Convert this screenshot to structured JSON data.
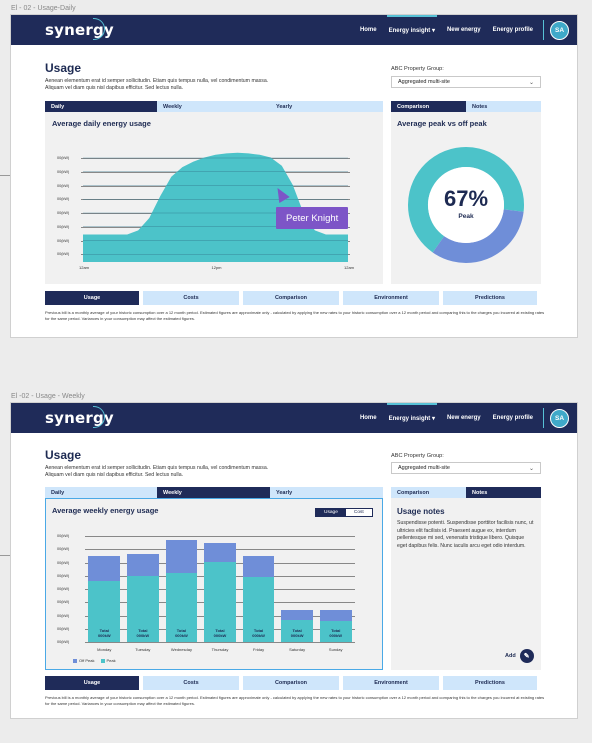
{
  "frames": [
    {
      "label": "El - 02 - Usage-Daily",
      "brand": "synergy",
      "nav": [
        "Home",
        "Energy insight ▾",
        "New energy",
        "Energy profile"
      ],
      "avatar": "SA",
      "title": "Usage",
      "description": "Aenean elementum erat id semper sollicitudin. Etiam quis tempus nulla, vel condimentum massa. Aliquam vel diam quis nisl dapibus efficitur. Sed lectus nulla.",
      "group_label": "ABC Property Group:",
      "group_value": "Aggregated multi-site",
      "period_tabs": [
        "Daily",
        "Weekly",
        "Yearly"
      ],
      "side_tabs": [
        "Comparison",
        "Notes"
      ],
      "chart_title": "Average daily energy usage",
      "y_ticks": [
        "00(kW)",
        "00(kW)",
        "00(kW)",
        "00(kW)",
        "00(kW)",
        "00(kW)",
        "00(kW)",
        "00(kW)"
      ],
      "x_ticks": [
        "12am",
        "12pm",
        "12am"
      ],
      "tooltip": "Peter Knight",
      "donut_title": "Average peak vs off peak",
      "donut_value": "67%",
      "donut_label": "Peak",
      "bottom_tabs": [
        "Usage",
        "Costs",
        "Comparison",
        "Environment",
        "Predictions"
      ],
      "footnote": "Previous bill is a monthly average of your historic consumption over a 12 month period. Estimated figures are approximate only - calculated by applying the new rates to your historic consumption over a 12 month period and comparing this to the charges you incurred at existing rates for the same period. Variances in your consumption may affect the estimated figures."
    },
    {
      "label": "El -02 - Usage - Weekly",
      "brand": "synergy",
      "nav": [
        "Home",
        "Energy insight ▾",
        "New energy",
        "Energy profile"
      ],
      "avatar": "SA",
      "title": "Usage",
      "description": "Aenean elementum erat id semper sollicitudin. Etiam quis tempus nulla, vel condimentum massa. Aliquam vel diam quis nisl dapibus efficitur. Sed lectus nulla.",
      "group_label": "ABC Property Group:",
      "group_value": "Aggregated multi-site",
      "period_tabs": [
        "Daily",
        "Weekly",
        "Yearly"
      ],
      "side_tabs": [
        "Comparison",
        "Notes"
      ],
      "chart_title": "Average weekly energy usage",
      "toggle": [
        "Usage",
        "Cost"
      ],
      "y_ticks": [
        "00(kW)",
        "00(kW)",
        "00(kW)",
        "00(kW)",
        "00(kW)",
        "00(kW)",
        "00(kW)",
        "00(kW)",
        "00(kW)"
      ],
      "bar_total_label": "Total",
      "bar_value_label": "000kW",
      "legend": [
        "Off Peak",
        "Peak"
      ],
      "notes_title": "Usage notes",
      "notes_text": "Suspendisse potenti. Suspendisse porttitor facilisis nunc, ut ultricies elit facilisis id. Praesent augue ex, interdum pellentesque mi sed, venenatis tristique libero. Quisque eget dapibus felis. Nunc iaculis arcu eget odio interdum.",
      "add_label": "Add",
      "bottom_tabs": [
        "Usage",
        "Costs",
        "Comparison",
        "Environment",
        "Predictions"
      ],
      "footnote": "Previous bill is a monthly average of your historic consumption over a 12 month period. Estimated figures are approximate only - calculated by applying the new rates to your historic consumption over a 12 month period and comparing this to the charges you incurred at existing rates for the same period. Variances in your consumption may affect the estimated figures."
    }
  ],
  "colors": {
    "navy": "#1f2b59",
    "teal": "#4cc3c9",
    "periwinkle": "#6f8ed8",
    "light_blue": "#cfe6fb",
    "purple": "#7d55c7"
  },
  "chart_data": [
    {
      "type": "area",
      "title": "Average daily energy usage",
      "x": [
        "12am",
        "",
        "",
        "",
        "",
        "",
        "",
        "",
        "",
        "",
        "",
        "",
        "12pm",
        "",
        "",
        "",
        "",
        "",
        "",
        "",
        "",
        "",
        "",
        "",
        "12am"
      ],
      "series": [
        {
          "values": [
            2,
            2,
            2,
            2,
            2,
            2.3,
            3.2,
            4.8,
            6.2,
            6.9,
            7.3,
            7.6,
            7.8,
            7.9,
            7.95,
            7.9,
            7.8,
            7.6,
            7,
            5.6,
            3.5,
            2.3,
            2,
            2,
            2
          ]
        }
      ],
      "ylim": [
        0,
        8
      ]
    },
    {
      "type": "pie",
      "title": "Average peak vs off peak",
      "categories": [
        "Peak",
        "Off Peak"
      ],
      "values": [
        67,
        33
      ]
    },
    {
      "type": "bar",
      "title": "Average weekly energy usage",
      "categories": [
        "Monday",
        "Tuesday",
        "Wednesday",
        "Thursday",
        "Friday",
        "Saturday",
        "Sunday"
      ],
      "series": [
        {
          "name": "Peak",
          "values": [
            5.2,
            5.6,
            5.9,
            6.8,
            5.5,
            1.9,
            1.8
          ]
        },
        {
          "name": "Off Peak",
          "values": [
            2.1,
            1.9,
            2.8,
            1.6,
            1.8,
            0.8,
            0.9
          ]
        }
      ],
      "ylim": [
        0,
        9
      ]
    }
  ]
}
